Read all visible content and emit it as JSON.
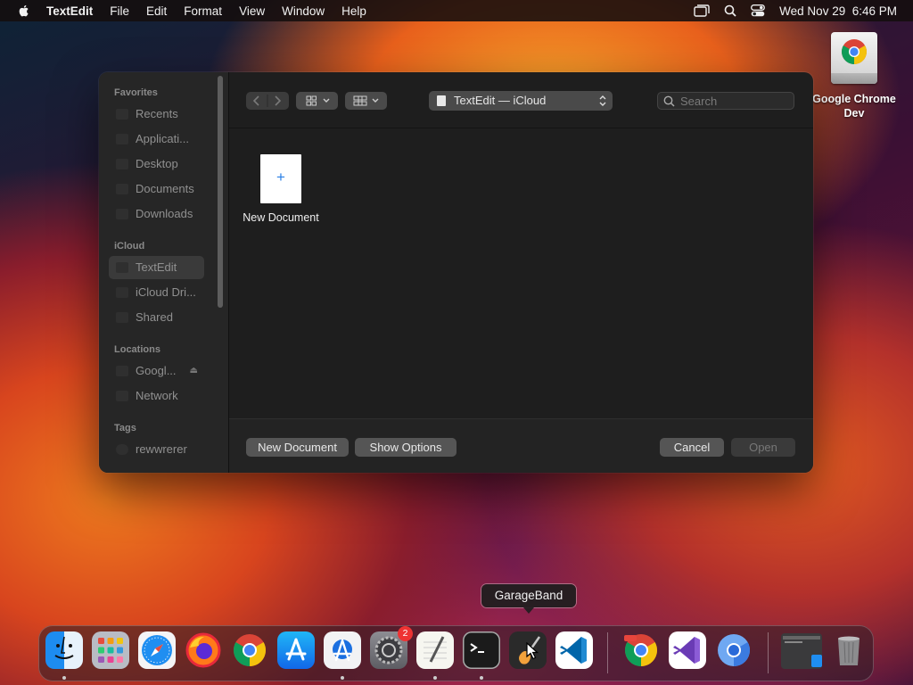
{
  "menubar": {
    "app_name": "TextEdit",
    "items": [
      "File",
      "Edit",
      "Format",
      "View",
      "Window",
      "Help"
    ],
    "datetime": "Wed Nov 29  6:46 PM",
    "icons": [
      "screen-mirroring-icon",
      "spotlight-icon",
      "control-center-icon"
    ]
  },
  "desktop": {
    "drive_label": "Google Chrome Dev"
  },
  "dialog": {
    "sidebar": {
      "favorites_header": "Favorites",
      "favorites": [
        "Recents",
        "Applicati...",
        "Desktop",
        "Documents",
        "Downloads"
      ],
      "icloud_header": "iCloud",
      "icloud": [
        "TextEdit",
        "iCloud Dri...",
        "Shared"
      ],
      "locations_header": "Locations",
      "locations": [
        "Googl...",
        "Network"
      ],
      "tags_header": "Tags",
      "tags": [
        "rewwrerer"
      ]
    },
    "path": "TextEdit — iCloud",
    "search_placeholder": "Search",
    "new_document_label": "New Document",
    "footer": {
      "new_document": "New Document",
      "show_options": "Show Options",
      "cancel": "Cancel",
      "open": "Open"
    }
  },
  "dock": {
    "tooltip": "GarageBand",
    "badge_count": "2",
    "apps": [
      "Finder",
      "Launchpad",
      "Safari",
      "Firefox",
      "Google Chrome",
      "App Store",
      "Xcode Instruments",
      "System Settings",
      "TextEdit",
      "Terminal",
      "GarageBand",
      "Visual Studio Code",
      "Google Chrome Dev",
      "Visual Studio",
      "Chromium",
      "Downloads",
      "Trash"
    ]
  }
}
